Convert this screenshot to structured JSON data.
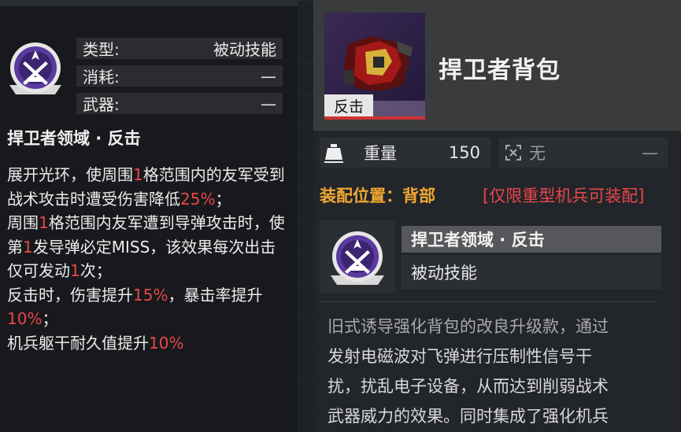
{
  "skill_panel": {
    "stats": [
      {
        "label": "类型:",
        "value": "被动技能"
      },
      {
        "label": "消耗:",
        "value": "—"
      },
      {
        "label": "武器:",
        "value": "—"
      }
    ],
    "title": "捍卫者领域 · 反击",
    "description": [
      [
        {
          "t": "展开光环，使周围"
        },
        {
          "t": "1",
          "red": true
        },
        {
          "t": "格范围内的友军受到战术攻击时遭受伤害降低"
        },
        {
          "t": "25%",
          "red": true
        },
        {
          "t": "；"
        }
      ],
      [
        {
          "t": "周围"
        },
        {
          "t": "1",
          "red": true
        },
        {
          "t": "格范围内友军遭到导弹攻击时，使第"
        },
        {
          "t": "1",
          "red": true
        },
        {
          "t": "发导弹必定MISS，该效果每次出击仅可发动"
        },
        {
          "t": "1",
          "red": true
        },
        {
          "t": "次；"
        }
      ],
      [
        {
          "t": "反击时，伤害提升"
        },
        {
          "t": "15%",
          "red": true
        },
        {
          "t": "，暴击率提升"
        },
        {
          "t": "10%",
          "red": true
        },
        {
          "t": "；"
        }
      ],
      [
        {
          "t": "机兵躯干耐久值提升"
        },
        {
          "t": "10%",
          "red": true
        }
      ]
    ]
  },
  "item_panel": {
    "thumb_tag": "反击",
    "name": "捍卫者背包",
    "weight_label": "重量",
    "weight_value": "150",
    "mod_value": "无",
    "mod_dash": "—",
    "slot_label": "装配位置：背部",
    "slot_restriction": "[仅限重型机兵可装配]",
    "skill_title": "捍卫者领域 · 反击",
    "skill_type": "被动技能",
    "lore_lines": [
      "旧式诱导强化背包的改良升级款，通过",
      "发射电磁波对飞弹进行压制性信号干",
      "扰，扰乱电子设备，从而达到削弱战术",
      "武器威力的效果。同时集成了强化机兵"
    ]
  },
  "colors": {
    "highlight_red": "#e8474a",
    "slot_orange": "#f0a830",
    "icon_purple": "#5b3aa0"
  },
  "icons": {
    "skill": "defender-domain-icon",
    "weight": "weight-icon",
    "mod": "mod-slot-icon"
  }
}
